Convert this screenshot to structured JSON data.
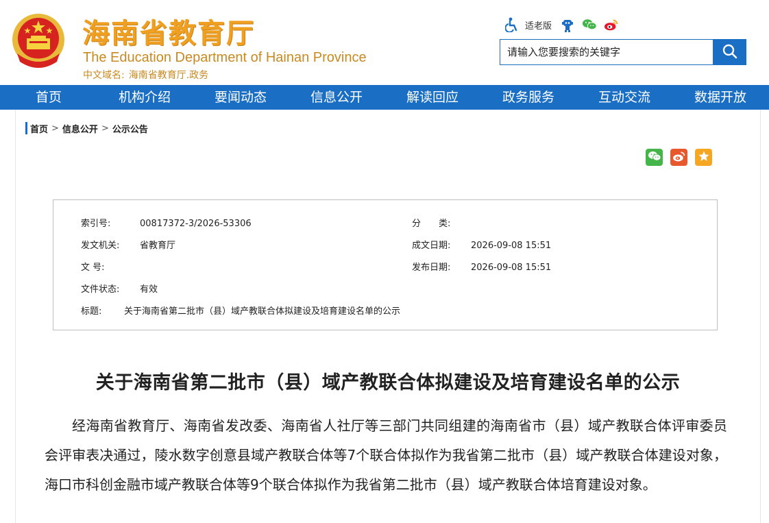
{
  "header": {
    "title_cn": "海南省教育厅",
    "title_en": "The Education Department of Hainan Province",
    "domain_label": "中文域名:",
    "domain_value": "海南省教育厅.政务",
    "elder_mode": "适老版",
    "search_placeholder": "请输入您要搜索的关键字"
  },
  "nav": {
    "items": [
      "首页",
      "机构介绍",
      "要闻动态",
      "信息公开",
      "解读回应",
      "政务服务",
      "互动交流",
      "数据开放"
    ]
  },
  "breadcrumb": {
    "items": [
      "首页",
      "信息公开",
      "公示公告"
    ],
    "separator": ">"
  },
  "info": {
    "index_label": "索引号:",
    "index_value": "00817372-3/2026-53306",
    "category_label": "分　　类:",
    "category_value": "",
    "issuer_label": "发文机关:",
    "issuer_value": "省教育厅",
    "created_label": "成文日期:",
    "created_value": "2026-09-08 15:51",
    "docno_label": "文  号:",
    "docno_value": "",
    "published_label": "发布日期:",
    "published_value": "2026-09-08 15:51",
    "status_label": "文件状态:",
    "status_value": "有效",
    "title_label": "标题:",
    "title_value": "关于海南省第二批市（县）域产教联合体拟建设及培育建设名单的公示"
  },
  "article": {
    "title": "关于海南省第二批市（县）域产教联合体拟建设及培育建设名单的公示",
    "body": "经海南省教育厅、海南省发改委、海南省人社厅等三部门共同组建的海南省市（县）域产教联合体评审委员会评审表决通过，陵水数字创意县域产教联合体等7个联合体拟作为我省第二批市（县）域产教联合体建设对象，海口市科创金融市域产教联合体等9个联合体拟作为我省第二批市（县）域产教联合体培育建设对象。"
  },
  "colors": {
    "brand_blue": "#1a6fc4",
    "title_gold": "#f0a021",
    "subtitle_gold": "#c98920"
  }
}
